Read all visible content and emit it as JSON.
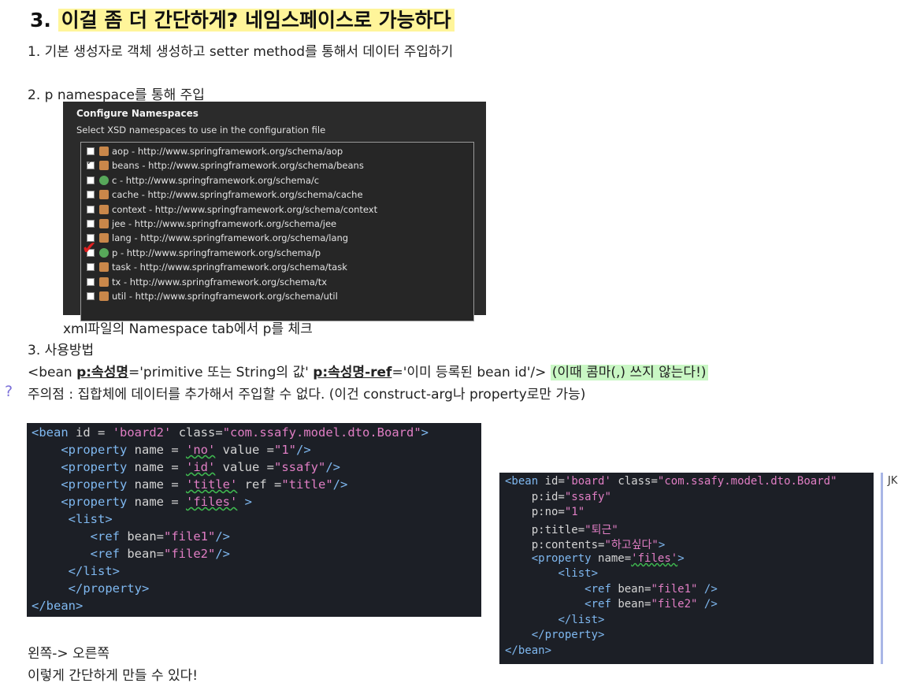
{
  "heading": {
    "number": "3.",
    "title": "이걸 좀 더 간단하게? 네임스페이스로 가능하다"
  },
  "lines": {
    "l1": "1. 기본 생성자로 객체 생성하고 setter method를 통해서 데이터 주입하기",
    "l2": "2. p namespace를 통해 주입",
    "caption": "xml파일의 Namespace tab에서 p를 체크",
    "l3": "3. 사용방법",
    "usage": {
      "a": "<bean ",
      "b": "p:속성명",
      "c": "='primitive 또는 String의 값' ",
      "d": "p:속성명-ref",
      "e": "='이미 등록된 bean id'/> ",
      "note": "(이때 콤마(,) 쓰지 않는다!)"
    },
    "caution": "주의점 : 집합체에 데이터를 추가해서 주입할 수 없다. (이건 construct-arg나 property로만 가능)",
    "bottom1": "왼쪽-> 오른쪽",
    "bottom2": "이렇게 간단하게 만들 수 있다!"
  },
  "qmark": "?",
  "dialog": {
    "title": "Configure Namespaces",
    "subtitle": "Select XSD namespaces to use in the configuration file",
    "items": [
      {
        "label": "aop - http://www.springframework.org/schema/aop",
        "checked": false
      },
      {
        "label": "beans - http://www.springframework.org/schema/beans",
        "checked": true
      },
      {
        "label": "c - http://www.springframework.org/schema/c",
        "checked": false
      },
      {
        "label": "cache - http://www.springframework.org/schema/cache",
        "checked": false
      },
      {
        "label": "context - http://www.springframework.org/schema/context",
        "checked": false
      },
      {
        "label": "jee - http://www.springframework.org/schema/jee",
        "checked": false
      },
      {
        "label": "lang - http://www.springframework.org/schema/lang",
        "checked": false
      },
      {
        "label": "p - http://www.springframework.org/schema/p",
        "checked": false
      },
      {
        "label": "task - http://www.springframework.org/schema/task",
        "checked": false
      },
      {
        "label": "tx - http://www.springframework.org/schema/tx",
        "checked": false
      },
      {
        "label": "util - http://www.springframework.org/schema/util",
        "checked": false
      }
    ]
  },
  "code_left": [
    "<bean id = 'board2' class=\"com.ssafy.model.dto.Board\">",
    "    <property name = 'no' value =\"1\"/>",
    "    <property name = 'id' value =\"ssafy\"/>",
    "    <property name = 'title' ref =\"title\"/>",
    "    <property name = 'files' >",
    "     <list>",
    "        <ref bean=\"file1\"/>",
    "        <ref bean=\"file2\"/>",
    "     </list>",
    "     </property>",
    "</bean>"
  ],
  "code_right": [
    "<bean id='board' class=\"com.ssafy.model.dto.Board\"",
    "    p:id=\"ssafy\"",
    "    p:no=\"1\"",
    "    p:title=\"퇴근\"",
    "    p:contents=\"하고싶다\">",
    "    <property name='files'>",
    "        <list>",
    "            <ref bean=\"file1\" />",
    "            <ref bean=\"file2\" />",
    "        </list>",
    "    </property>",
    "</bean>"
  ],
  "comment_author": "JK",
  "colors": {
    "heading_highlight": "#fff59a",
    "note_highlight": "#c9f7c4",
    "code_bg": "#1c1f26"
  }
}
